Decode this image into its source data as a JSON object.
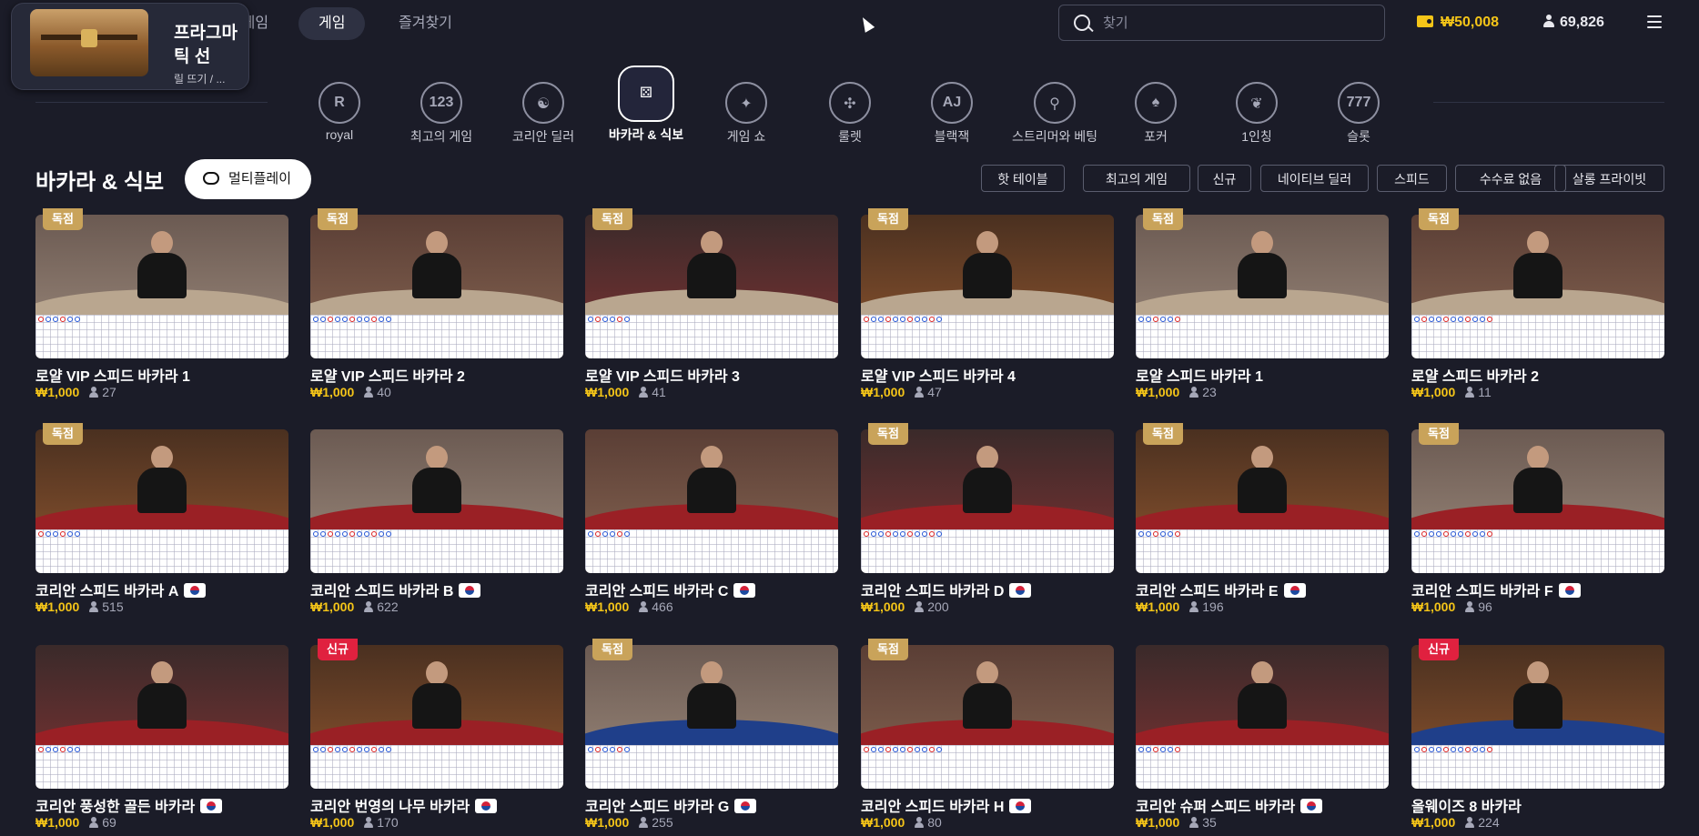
{
  "header": {
    "tabs": [
      {
        "label": "카지노 게임"
      },
      {
        "label": "게임"
      },
      {
        "label": "즐겨찾기"
      }
    ],
    "promo": {
      "title": "프라그마틱 선",
      "subtitle": "릴 뜨기 / ..."
    },
    "search": {
      "placeholder": "찾기"
    },
    "balance": "₩50,008",
    "players_online": "69,826"
  },
  "categories": [
    {
      "label": "royal",
      "icon": "royal-crest-icon",
      "glyph": "R"
    },
    {
      "label": "최고의 게임",
      "icon": "podium-icon",
      "glyph": "123"
    },
    {
      "label": "코리안 딜러",
      "icon": "korean-fan-icon",
      "glyph": "☯"
    },
    {
      "label": "바카라 & 식보",
      "icon": "dice-player-icon",
      "glyph": "⚄"
    },
    {
      "label": "게임 쇼",
      "icon": "microphone-stars-icon",
      "glyph": "✦"
    },
    {
      "label": "룰렛",
      "icon": "roulette-wheel-icon",
      "glyph": "✣"
    },
    {
      "label": "블랙잭",
      "icon": "blackjack-cards-icon",
      "glyph": "AJ"
    },
    {
      "label": "스트리머와 베팅",
      "icon": "streamer-mic-icon",
      "glyph": "⚲"
    },
    {
      "label": "포커",
      "icon": "poker-cards-icon",
      "glyph": "♠"
    },
    {
      "label": "1인칭",
      "icon": "first-person-leaf-icon",
      "glyph": "❦"
    },
    {
      "label": "슬롯",
      "icon": "slot-machine-icon",
      "glyph": "777"
    }
  ],
  "section": {
    "title": "바카라 & 식보",
    "multiplay_label": "멀티플레이",
    "filters": [
      "핫 테이블",
      "최고의 게임",
      "신규",
      "네이티브 딜러",
      "스피드",
      "수수료 없음",
      "살롱 프라이빗"
    ]
  },
  "games": [
    {
      "title": "로얄 VIP 스피드 바카라 1",
      "bet": "₩1,000",
      "players": "27",
      "badge": "독점",
      "flag": false
    },
    {
      "title": "로얄 VIP 스피드 바카라 2",
      "bet": "₩1,000",
      "players": "40",
      "badge": "독점",
      "flag": false
    },
    {
      "title": "로얄 VIP 스피드 바카라 3",
      "bet": "₩1,000",
      "players": "41",
      "badge": "독점",
      "flag": false
    },
    {
      "title": "로얄 VIP 스피드 바카라 4",
      "bet": "₩1,000",
      "players": "47",
      "badge": "독점",
      "flag": false
    },
    {
      "title": "로얄 스피드 바카라 1",
      "bet": "₩1,000",
      "players": "23",
      "badge": "독점",
      "flag": false
    },
    {
      "title": "로얄 스피드 바카라 2",
      "bet": "₩1,000",
      "players": "11",
      "badge": "독점",
      "flag": false
    },
    {
      "title": "코리안 스피드 바카라 A",
      "bet": "₩1,000",
      "players": "515",
      "badge": "독점",
      "flag": true
    },
    {
      "title": "코리안 스피드 바카라 B",
      "bet": "₩1,000",
      "players": "622",
      "badge": "",
      "flag": true
    },
    {
      "title": "코리안 스피드 바카라 C",
      "bet": "₩1,000",
      "players": "466",
      "badge": "",
      "flag": true
    },
    {
      "title": "코리안 스피드 바카라 D",
      "bet": "₩1,000",
      "players": "200",
      "badge": "독점",
      "flag": true
    },
    {
      "title": "코리안 스피드 바카라 E",
      "bet": "₩1,000",
      "players": "196",
      "badge": "독점",
      "flag": true
    },
    {
      "title": "코리안 스피드 바카라 F",
      "bet": "₩1,000",
      "players": "96",
      "badge": "독점",
      "flag": true
    },
    {
      "title": "코리안 풍성한 골든 바카라",
      "bet": "₩1,000",
      "players": "69",
      "badge": "",
      "flag": true
    },
    {
      "title": "코리안 번영의 나무 바카라",
      "bet": "₩1,000",
      "players": "170",
      "badge": "신규",
      "flag": true
    },
    {
      "title": "코리안 스피드 바카라 G",
      "bet": "₩1,000",
      "players": "255",
      "badge": "독점",
      "flag": true
    },
    {
      "title": "코리안 스피드 바카라 H",
      "bet": "₩1,000",
      "players": "80",
      "badge": "독점",
      "flag": true
    },
    {
      "title": "코리안 슈퍼 스피드 바카라",
      "bet": "₩1,000",
      "players": "35",
      "badge": "",
      "flag": true
    },
    {
      "title": "올웨이즈 8 바카라",
      "bet": "₩1,000",
      "players": "224",
      "badge": "신규",
      "flag": false
    }
  ],
  "colors": {
    "background": "#1b1c28",
    "accent_gold": "#f5c518",
    "badge_exclusive": "#c9a35a",
    "badge_new": "#e0213f"
  }
}
